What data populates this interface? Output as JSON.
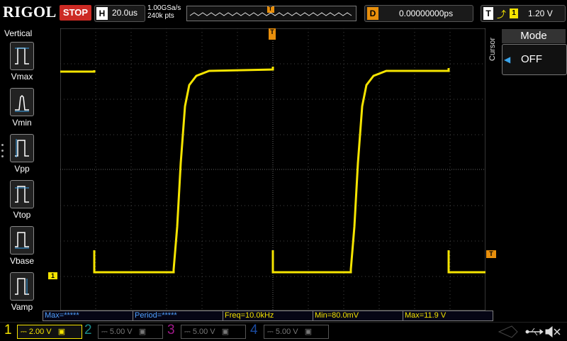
{
  "header": {
    "logo": "RIGOL",
    "run_stop": "STOP",
    "h_label": "H",
    "timebase": "20.0us",
    "sample_rate": "1.00GSa/s",
    "memory_depth": "240k pts",
    "trigger_marker": "T",
    "d_label": "D",
    "delay": "0.00000000ps",
    "t_label": "T",
    "trigger_source": "1",
    "trigger_level": "1.20 V"
  },
  "left_menu": {
    "title": "Vertical",
    "items": [
      "Vmax",
      "Vmin",
      "Vpp",
      "Vtop",
      "Vbase",
      "Vamp"
    ]
  },
  "right_panel": {
    "cursor_label": "Cursor",
    "mode_title": "Mode",
    "mode_value": "OFF"
  },
  "markers": {
    "trigger_position": "T",
    "trigger_level": "T",
    "ch1": "1"
  },
  "measurements": [
    {
      "label": "Max=*****",
      "style": "blue"
    },
    {
      "label": "Period=*****",
      "style": "blue"
    },
    {
      "label": "Freq=10.0kHz",
      "style": "yellow"
    },
    {
      "label": "Min=80.0mV",
      "style": "yellow"
    },
    {
      "label": "Max=11.9 V",
      "style": "yellow"
    }
  ],
  "channels": [
    {
      "num": "1",
      "coupling": "⎓",
      "scale": "2.00 V",
      "color": "#f5e400",
      "active": true
    },
    {
      "num": "2",
      "coupling": "⎓",
      "scale": "5.00 V",
      "color": "#1a8a8a",
      "active": false
    },
    {
      "num": "3",
      "coupling": "⎓",
      "scale": "5.00 V",
      "color": "#a01a8a",
      "active": false
    },
    {
      "num": "4",
      "coupling": "⎓",
      "scale": "5.00 V",
      "color": "#1a4aa0",
      "active": false
    }
  ],
  "colors": {
    "ch1": "#f5e400",
    "stop": "#cc2a24",
    "trigger": "#e88f0c",
    "grid": "#6a6a6a"
  }
}
